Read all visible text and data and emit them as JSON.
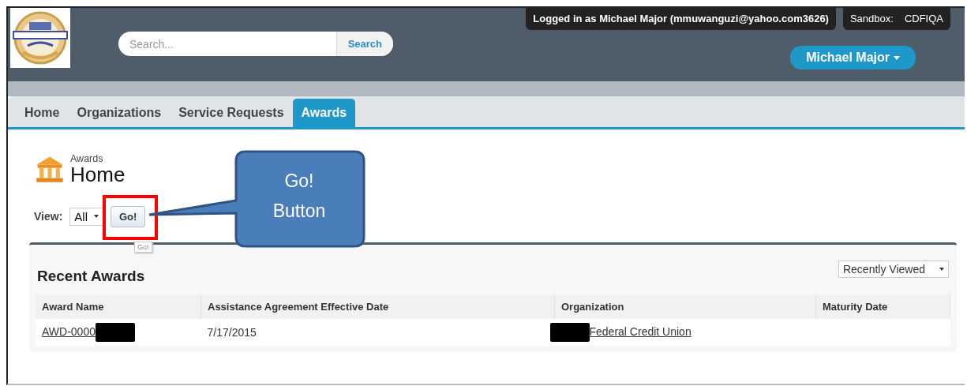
{
  "header": {
    "search": {
      "placeholder": "Search...",
      "button": "Search"
    },
    "login_info": "Logged in as Michael Major (mmuwanguzi@yahoo.com3626)",
    "sandbox": {
      "label": "Sandbox:",
      "value": "CDFIQA"
    },
    "user_menu": "Michael Major"
  },
  "tabs": [
    {
      "label": "Home",
      "selected": false
    },
    {
      "label": "Organizations",
      "selected": false
    },
    {
      "label": "Service Requests",
      "selected": false
    },
    {
      "label": "Awards",
      "selected": true
    }
  ],
  "page": {
    "breadcrumb": "Awards",
    "title": "Home",
    "view": {
      "label": "View:",
      "value": "All",
      "button": "Go!"
    },
    "tooltip": "Go!"
  },
  "callout": {
    "text": "Go!\nButton"
  },
  "recent": {
    "title": "Recent Awards",
    "filter": "Recently Viewed",
    "columns": [
      "Award Name",
      "Assistance Agreement Effective Date",
      "Organization",
      "Maturity Date"
    ],
    "rows": [
      {
        "cells": [
          {
            "text": "AWD-0000",
            "link": true,
            "redacted_before": false,
            "redacted_after": true
          },
          {
            "text": "7/17/2015",
            "link": false,
            "redacted_before": false,
            "redacted_after": false
          },
          {
            "text": "Federal Credit Union",
            "link": true,
            "redacted_before": true,
            "redacted_after": false
          }
        ]
      }
    ]
  }
}
